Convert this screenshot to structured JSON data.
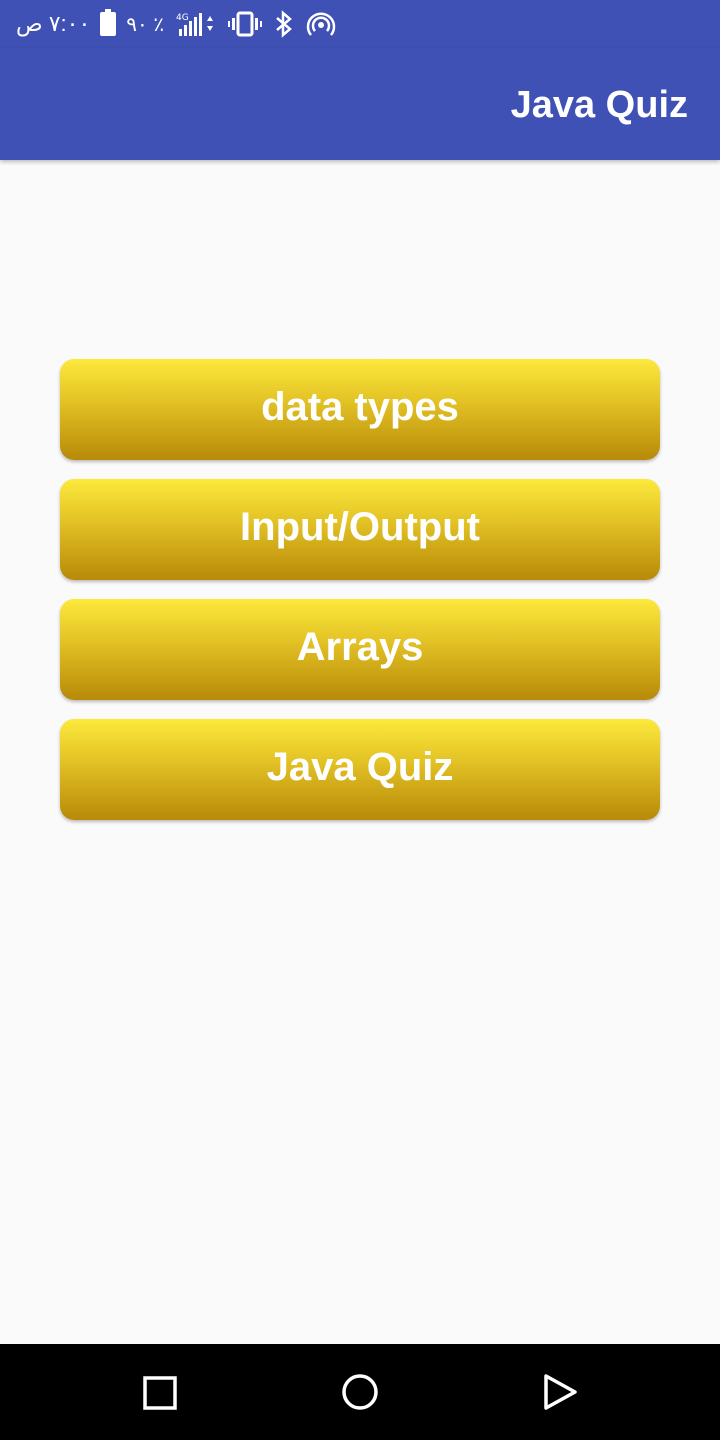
{
  "status_bar": {
    "time": "٧:٠٠ ص",
    "battery_percent": "٩٠ ٪",
    "icons": [
      "battery-icon",
      "signal-4g-icon",
      "vibrate-icon",
      "bluetooth-icon",
      "hotspot-icon"
    ]
  },
  "app_bar": {
    "title": "Java Quiz",
    "color": "#3f51b5"
  },
  "menu": {
    "items": [
      {
        "label": "data types"
      },
      {
        "label": "Input/Output"
      },
      {
        "label": "Arrays"
      },
      {
        "label": "Java Quiz"
      }
    ]
  },
  "nav_bar": {
    "icons": [
      "recent-apps-icon",
      "home-icon",
      "back-icon"
    ]
  }
}
